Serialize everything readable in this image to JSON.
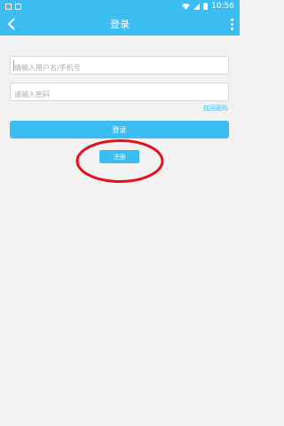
{
  "status_bar": {
    "time": "10:56"
  },
  "header": {
    "title": "登录"
  },
  "form": {
    "username_placeholder": "请输入用户名/手机号",
    "password_placeholder": "请输入密码",
    "forgot_label": "找回密码",
    "login_label": "登录",
    "register_label": "注册"
  },
  "colors": {
    "accent": "#3bbdf2",
    "annotation": "#e0121b"
  }
}
